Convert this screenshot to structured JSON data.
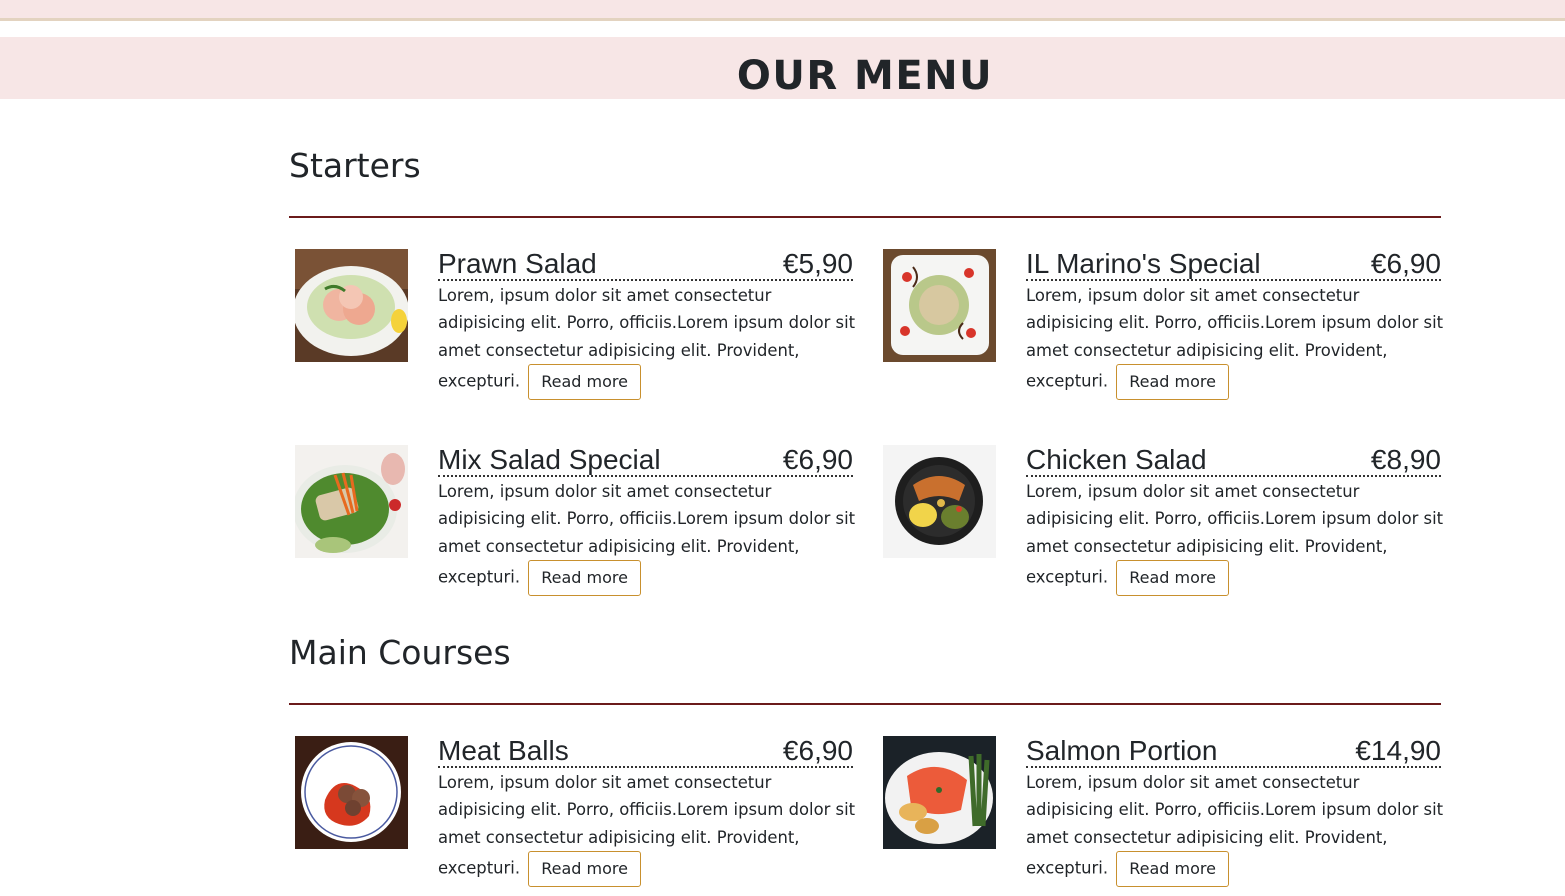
{
  "page": {
    "title": "OUR MENU"
  },
  "sections": [
    {
      "title": "Starters",
      "items": [
        {
          "name": "Prawn Salad",
          "price": "€5,90",
          "desc": "Lorem, ipsum dolor sit amet consectetur adipisicing elit. Porro, officiis.Lorem ipsum dolor sit amet consectetur adipisicing elit. Provident, excepturi.",
          "button": "Read more"
        },
        {
          "name": "IL Marino's Special",
          "price": "€6,90",
          "desc": "Lorem, ipsum dolor sit amet consectetur adipisicing elit. Porro, officiis.Lorem ipsum dolor sit amet consectetur adipisicing elit. Provident, excepturi.",
          "button": "Read more"
        },
        {
          "name": "Mix Salad Special",
          "price": "€6,90",
          "desc": "Lorem, ipsum dolor sit amet consectetur adipisicing elit. Porro, officiis.Lorem ipsum dolor sit amet consectetur adipisicing elit. Provident, excepturi.",
          "button": "Read more"
        },
        {
          "name": "Chicken Salad",
          "price": "€8,90",
          "desc": "Lorem, ipsum dolor sit amet consectetur adipisicing elit. Porro, officiis.Lorem ipsum dolor sit amet consectetur adipisicing elit. Provident, excepturi.",
          "button": "Read more"
        }
      ]
    },
    {
      "title": "Main Courses",
      "items": [
        {
          "name": "Meat Balls",
          "price": "€6,90",
          "desc": "Lorem, ipsum dolor sit amet consectetur adipisicing elit. Porro, officiis.Lorem ipsum dolor sit amet consectetur adipisicing elit. Provident, excepturi.",
          "button": "Read more"
        },
        {
          "name": "Salmon Portion",
          "price": "€14,90",
          "desc": "Lorem, ipsum dolor sit amet consectetur adipisicing elit. Porro, officiis.Lorem ipsum dolor sit amet consectetur adipisicing elit. Provident, excepturi.",
          "button": "Read more"
        }
      ]
    }
  ]
}
